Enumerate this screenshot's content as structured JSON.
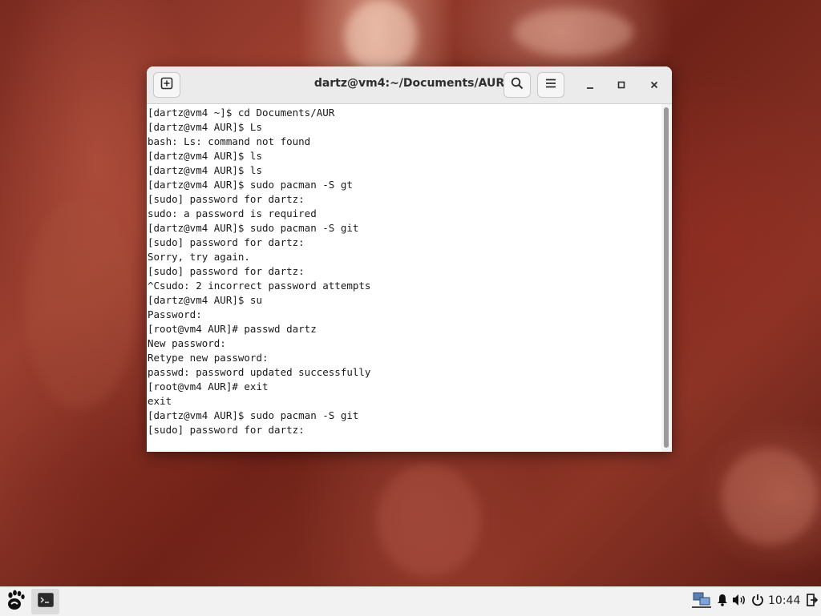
{
  "window": {
    "title": "dartz@vm4:~/Documents/AUR",
    "icons": {
      "new_tab": "new-tab-icon",
      "search": "search-icon",
      "menu": "hamburger-menu-icon",
      "minimize": "minimize-icon",
      "maximize": "maximize-icon",
      "close": "close-icon"
    }
  },
  "terminal": {
    "lines": [
      "[dartz@vm4 ~]$ cd Documents/AUR",
      "[dartz@vm4 AUR]$ Ls",
      "bash: Ls: command not found",
      "[dartz@vm4 AUR]$ ls",
      "[dartz@vm4 AUR]$ ls",
      "[dartz@vm4 AUR]$ sudo pacman -S gt",
      "[sudo] password for dartz:",
      "sudo: a password is required",
      "[dartz@vm4 AUR]$ sudo pacman -S git",
      "[sudo] password for dartz:",
      "Sorry, try again.",
      "[sudo] password for dartz:",
      "^Csudo: 2 incorrect password attempts",
      "[dartz@vm4 AUR]$ su",
      "Password:",
      "[root@vm4 AUR]# passwd dartz",
      "New password:",
      "Retype new password:",
      "passwd: password updated successfully",
      "[root@vm4 AUR]# exit",
      "exit",
      "[dartz@vm4 AUR]$ sudo pacman -S git",
      "[sudo] password for dartz:"
    ]
  },
  "taskbar": {
    "clock": "10:44",
    "icons": {
      "start": "gnome-foot-icon",
      "terminal_app": "terminal-icon",
      "network": "network-icon",
      "notifications": "bell-icon",
      "volume": "volume-icon",
      "power": "power-icon",
      "logout": "logout-icon"
    }
  },
  "colors": {
    "headerbar": "#ebebeb",
    "terminal_bg": "#ffffff",
    "terminal_fg": "#1a1a1a",
    "taskbar": "#f2f2f2"
  }
}
